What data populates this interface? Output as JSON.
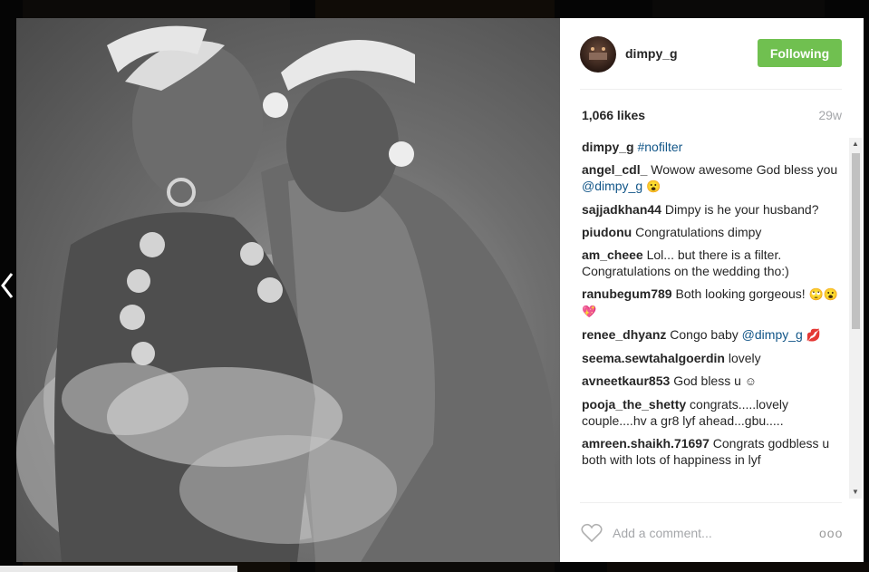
{
  "post": {
    "username": "dimpy_g",
    "follow_label": "Following",
    "likes": "1,066 likes",
    "age": "29w",
    "add_comment_placeholder": "Add a comment...",
    "more_label": "ooo"
  },
  "comments": [
    {
      "user": "dimpy_g",
      "text": "",
      "link": "#nofilter",
      "tail": "",
      "emoji": ""
    },
    {
      "user": "angel_cdl_",
      "text": "Wowow awesome God bless you ",
      "link": "@dimpy_g",
      "tail": " ",
      "emoji": "😮"
    },
    {
      "user": "sajjadkhan44",
      "text": "Dimpy is he your husband?",
      "link": "",
      "tail": "",
      "emoji": ""
    },
    {
      "user": "piudonu",
      "text": "Congratulations dimpy",
      "link": "",
      "tail": "",
      "emoji": ""
    },
    {
      "user": "am_cheee",
      "text": "Lol... but there is a filter. Congratulations on the wedding tho:)",
      "link": "",
      "tail": "",
      "emoji": ""
    },
    {
      "user": "ranubegum789",
      "text": "Both looking gorgeous! ",
      "link": "",
      "tail": "",
      "emoji": "🙄😮💖"
    },
    {
      "user": "renee_dhyanz",
      "text": "Congo baby ",
      "link": "@dimpy_g",
      "tail": " ",
      "emoji": "💋"
    },
    {
      "user": "seema.sewtahalgoerdin",
      "text": "lovely",
      "link": "",
      "tail": "",
      "emoji": ""
    },
    {
      "user": "avneetkaur853",
      "text": "God bless u ",
      "link": "",
      "tail": "",
      "emoji": "☺"
    },
    {
      "user": "pooja_the_shetty",
      "text": "congrats.....lovely couple....hv a gr8 lyf ahead...gbu.....",
      "link": "",
      "tail": "",
      "emoji": ""
    },
    {
      "user": "amreen.shaikh.71697",
      "text": "Congrats godbless u both with lots of happiness in lyf",
      "link": "",
      "tail": "",
      "emoji": ""
    }
  ],
  "colors": {
    "follow_bg": "#70c050",
    "link": "#125688",
    "muted": "#a5a7aa"
  },
  "icons": [
    "chevron-left-icon",
    "heart-icon",
    "scroll-up-icon",
    "scroll-down-icon"
  ]
}
